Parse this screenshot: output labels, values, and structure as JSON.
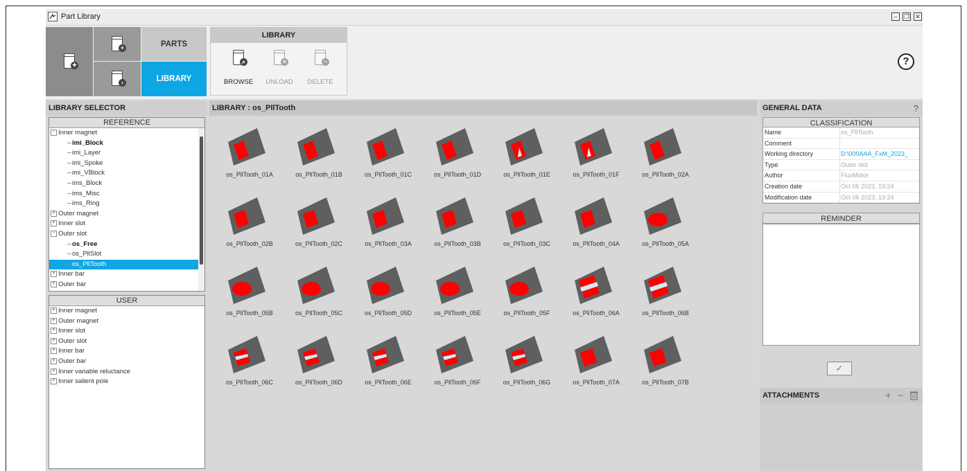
{
  "window": {
    "title": "Part Library",
    "icon": "part-library-icon"
  },
  "toolbar": {
    "parts_label": "PARTS",
    "library_label": "LIBRARY",
    "library_group": {
      "title": "LIBRARY",
      "buttons": [
        {
          "label": "BROWSE",
          "icon": "browse-icon",
          "enabled": true
        },
        {
          "label": "UNLOAD",
          "icon": "unload-icon",
          "enabled": false
        },
        {
          "label": "DELETE",
          "icon": "delete-icon",
          "enabled": false
        }
      ]
    },
    "help_glyph": "?"
  },
  "library_selector": {
    "title": "LIBRARY SELECTOR",
    "reference": {
      "title": "REFERENCE",
      "items": [
        {
          "label": "Inner magnet",
          "level": 0,
          "expander": "-"
        },
        {
          "label": "imi_Block",
          "level": 1,
          "bold": true
        },
        {
          "label": "imi_Layer",
          "level": 1
        },
        {
          "label": "imi_Spoke",
          "level": 1
        },
        {
          "label": "imi_VBlock",
          "level": 1
        },
        {
          "label": "ims_Block",
          "level": 1
        },
        {
          "label": "ims_Misc",
          "level": 1
        },
        {
          "label": "ims_Ring",
          "level": 1
        },
        {
          "label": "Outer magnet",
          "level": 0,
          "expander": "+"
        },
        {
          "label": "Inner slot",
          "level": 0,
          "expander": "+"
        },
        {
          "label": "Outer slot",
          "level": 0,
          "expander": "-"
        },
        {
          "label": "os_Free",
          "level": 1,
          "bold": true
        },
        {
          "label": "os_PllSlot",
          "level": 1
        },
        {
          "label": "os_PllTooth",
          "level": 1,
          "selected": true
        },
        {
          "label": "Inner bar",
          "level": 0,
          "expander": "+"
        },
        {
          "label": "Outer bar",
          "level": 0,
          "expander": "+"
        }
      ]
    },
    "user": {
      "title": "USER",
      "items": [
        {
          "label": "Inner magnet",
          "expander": "+"
        },
        {
          "label": "Outer magnet",
          "expander": "+"
        },
        {
          "label": "Inner slot",
          "expander": "+"
        },
        {
          "label": "Outer slot",
          "expander": "+"
        },
        {
          "label": "Inner bar",
          "expander": "+"
        },
        {
          "label": "Outer bar",
          "expander": "+"
        },
        {
          "label": "Inner variable reluctance",
          "expander": "+"
        },
        {
          "label": "Inner salient pole",
          "expander": "+"
        }
      ]
    }
  },
  "library": {
    "title": "LIBRARY : os_PllTooth",
    "parts": [
      "os_PllTooth_01A",
      "os_PllTooth_01B",
      "os_PllTooth_01C",
      "os_PllTooth_01D",
      "os_PllTooth_01E",
      "os_PllTooth_01F",
      "os_PllTooth_02A",
      "os_PllTooth_02B",
      "os_PllTooth_02C",
      "os_PllTooth_03A",
      "os_PllTooth_03B",
      "os_PllTooth_03C",
      "os_PllTooth_04A",
      "os_PllTooth_05A",
      "os_PllTooth_05B",
      "os_PllTooth_05C",
      "os_PllTooth_05D",
      "os_PllTooth_05E",
      "os_PllTooth_05F",
      "os_PllTooth_06A",
      "os_PllTooth_06B",
      "os_PllTooth_06C",
      "os_PllTooth_06D",
      "os_PllTooth_06E",
      "os_PllTooth_06F",
      "os_PllTooth_06G",
      "os_PllTooth_07A",
      "os_PllTooth_07B"
    ],
    "colors": {
      "sector": "#5f5f5f",
      "tooth": "#ff0000",
      "insert": "#cfeef5"
    }
  },
  "general_data": {
    "title": "GENERAL DATA",
    "help_glyph": "?",
    "classification": {
      "title": "CLASSIFICATION",
      "rows": [
        {
          "key": "Name",
          "value": "os_PllTooth"
        },
        {
          "key": "Comment",
          "value": ""
        },
        {
          "key": "Working directory",
          "value": "D:\\000AAA_FxM_2023_",
          "link": true
        },
        {
          "key": "Type",
          "value": "Outer slot"
        },
        {
          "key": "Author",
          "value": "FluxMotor"
        },
        {
          "key": "Creation date",
          "value": "Oct 06 2023, 19:24"
        },
        {
          "key": "Modification date",
          "value": "Oct 06 2023, 19:24"
        }
      ]
    },
    "reminder": {
      "title": "REMINDER"
    },
    "validate_glyph": "✓"
  },
  "attachments": {
    "title": "ATTACHMENTS",
    "add_glyph": "+",
    "remove_glyph": "−"
  },
  "accent_color": "#0ea6e3"
}
